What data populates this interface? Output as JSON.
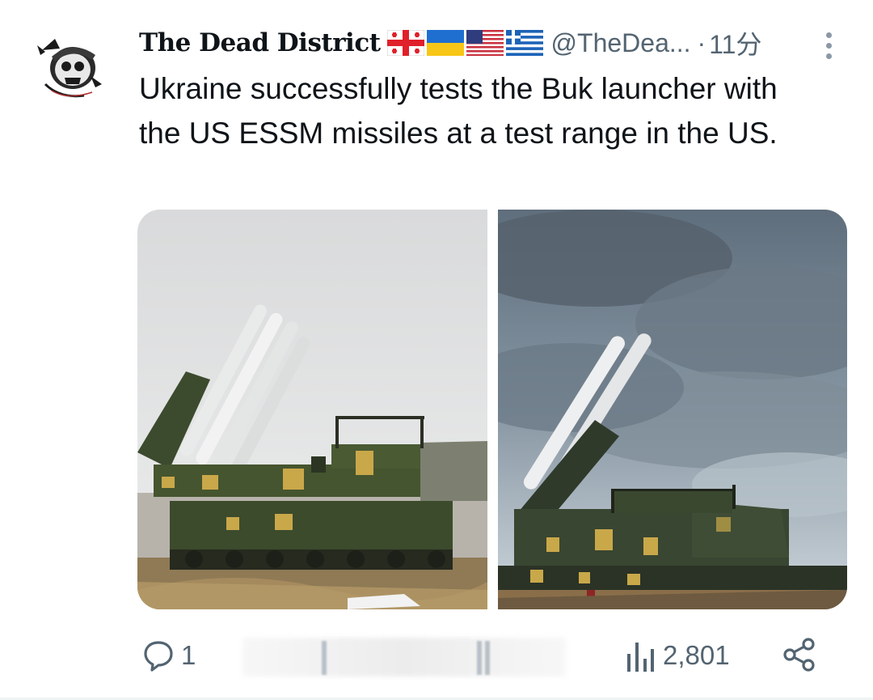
{
  "author": {
    "display_name": "The Dead District",
    "flags": [
      "georgia-flag-icon",
      "ukraine-flag-icon",
      "usa-flag-icon",
      "greece-flag-icon"
    ],
    "handle": "@TheDea...",
    "separator": "·",
    "time": "11分"
  },
  "tweet": {
    "text": "Ukraine successfully tests the Buk launcher with the US ESSM missiles at a test range in the US."
  },
  "media": {
    "count": 2,
    "images": [
      "buk-launcher-photo-1",
      "buk-launcher-photo-2"
    ]
  },
  "actions": {
    "reply_icon": "speech-bubble-icon",
    "reply_count": "1",
    "views_icon": "bar-chart-icon",
    "views_count": "2,801",
    "share_icon": "share-nodes-icon"
  },
  "colors": {
    "text": "#0f1419",
    "muted": "#536471",
    "background": "#ffffff"
  }
}
